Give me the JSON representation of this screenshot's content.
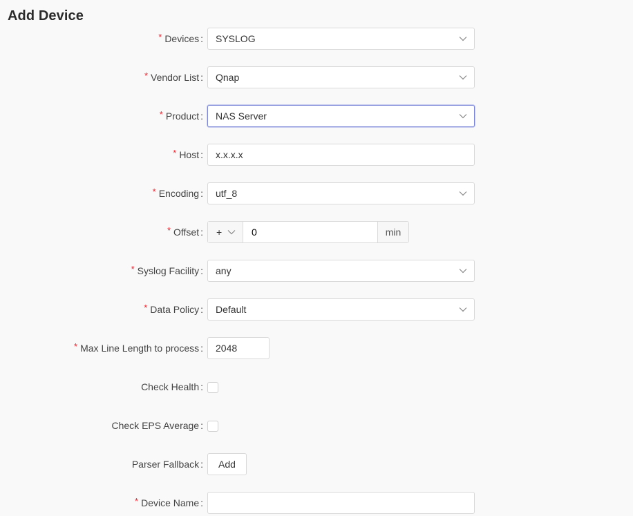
{
  "page": {
    "title": "Add Device"
  },
  "required_mark": "*",
  "colon": ":",
  "fields": {
    "devices": {
      "label": "Devices",
      "value": "SYSLOG"
    },
    "vendor_list": {
      "label": "Vendor List",
      "value": "Qnap"
    },
    "product": {
      "label": "Product",
      "value": "NAS Server"
    },
    "host": {
      "label": "Host",
      "value": "x.x.x.x"
    },
    "encoding": {
      "label": "Encoding",
      "value": "utf_8"
    },
    "offset": {
      "label": "Offset",
      "sign": "+",
      "value": "0",
      "unit": "min"
    },
    "syslog_facility": {
      "label": "Syslog Facility",
      "value": "any"
    },
    "data_policy": {
      "label": "Data Policy",
      "value": "Default"
    },
    "max_line_length": {
      "label": "Max Line Length to process",
      "value": "2048"
    },
    "check_health": {
      "label": "Check Health",
      "checked": false
    },
    "check_eps_average": {
      "label": "Check EPS Average",
      "checked": false
    },
    "parser_fallback": {
      "label": "Parser Fallback",
      "button_label": "Add"
    },
    "device_name": {
      "label": "Device Name",
      "value": ""
    }
  },
  "icons": {
    "dropdown": "chevron-down-icon"
  },
  "colors": {
    "background": "#f9f9f9",
    "required": "#f5222d",
    "focus_border": "#7b86d8",
    "border": "#d9d9d9"
  }
}
